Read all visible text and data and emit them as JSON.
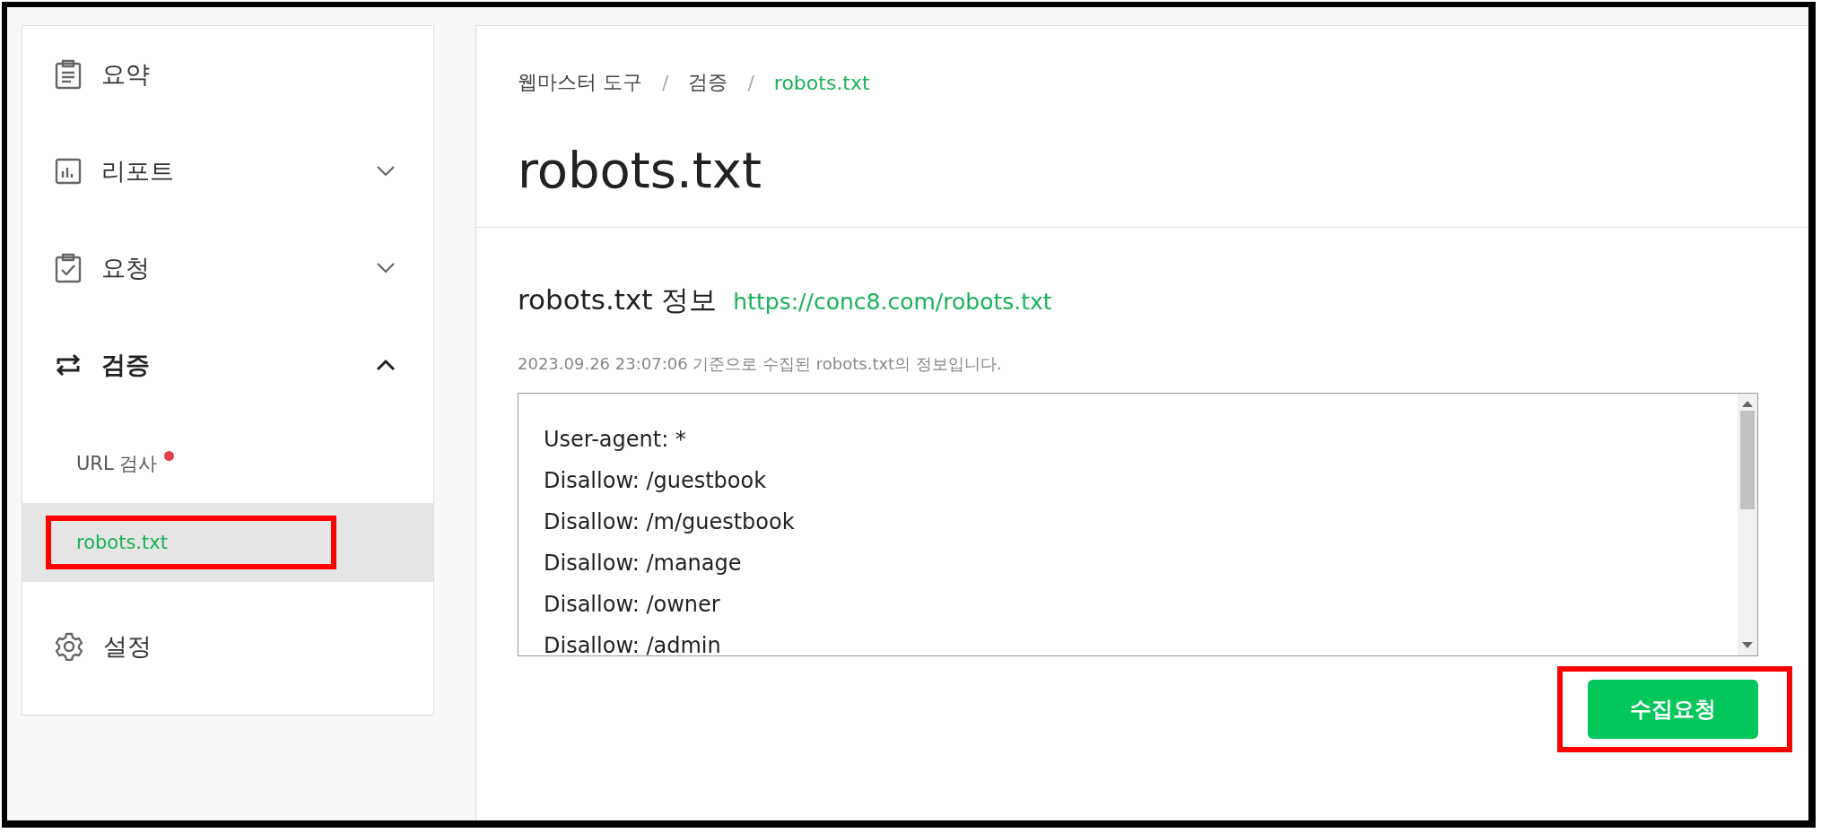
{
  "sidebar": {
    "items": [
      {
        "label": "요약",
        "selected": false
      },
      {
        "label": "리포트",
        "selected": false,
        "expanded": false
      },
      {
        "label": "요청",
        "selected": false,
        "expanded": false
      },
      {
        "label": "검증",
        "selected": true,
        "expanded": true,
        "children": [
          {
            "label": "URL 검사",
            "selected": false,
            "notified": true,
            "highlighted": false
          },
          {
            "label": "robots.txt",
            "selected": true,
            "notified": false,
            "highlighted": true
          }
        ]
      },
      {
        "label": "설정",
        "selected": false
      }
    ]
  },
  "breadcrumb": [
    {
      "label": "웹마스터 도구",
      "current": false
    },
    {
      "label": "검증",
      "current": false
    },
    {
      "label": "robots.txt",
      "current": true
    }
  ],
  "breadcrumb_separator": "/",
  "title": "robots.txt",
  "section": {
    "heading": "robots.txt 정보",
    "url": "https://conc8.com/robots.txt",
    "note": "2023.09.26 23:07:06 기준으로 수집된 robots.txt의 정보입니다.",
    "lines": [
      "User-agent: *",
      "Disallow: /guestbook",
      "Disallow: /m/guestbook",
      "Disallow: /manage",
      "Disallow: /owner",
      "Disallow: /admin"
    ]
  },
  "button": {
    "label": "수집요청",
    "highlighted": true
  }
}
